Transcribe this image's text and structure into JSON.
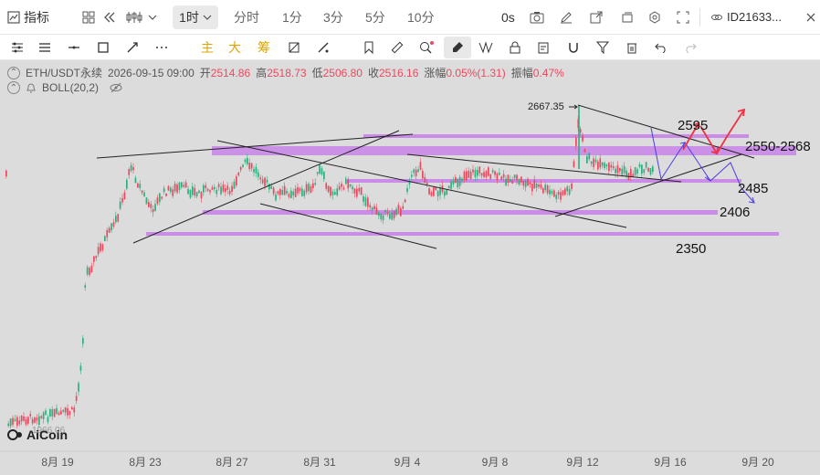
{
  "toolbar_top": {
    "indicator_label": "指标",
    "timeframe_selected": "1时",
    "timeframes": [
      "分时",
      "1分",
      "3分",
      "5分",
      "10分"
    ],
    "countdown": "0s",
    "account_id": "ID21633..."
  },
  "drawing_tools": {
    "main_label": "主",
    "big_label": "大",
    "chip_label": "筹"
  },
  "instrument": {
    "symbol": "ETH/USDT永续",
    "datetime": "2026-09-15 09:00",
    "open_label": "开",
    "open": "2514.86",
    "high_label": "高",
    "high": "2518.73",
    "low_label": "低",
    "low": "2506.80",
    "close_label": "收",
    "close": "2516.16",
    "change_label": "涨幅",
    "change": "0.05%(1.31)",
    "amplitude_label": "振幅",
    "amplitude": "0.47%"
  },
  "indicator": {
    "name": "BOLL(20,2)"
  },
  "brand": {
    "name": "AiCoin",
    "low_value": "1966.06"
  },
  "colors": {
    "up": "#2fae7e",
    "down": "#e84a5f",
    "band": "#c77ee8",
    "arrow_red": "#ee3344",
    "arrow_blue": "#4b3fe0"
  },
  "chart_data": {
    "type": "candlestick",
    "x_ticks": [
      "8月 19",
      "8月 23",
      "8月 27",
      "8月 31",
      "9月 4",
      "9月 8",
      "9月 12",
      "9月 16",
      "9月 20"
    ],
    "peak_label": "2667.35",
    "levels": [
      {
        "label": "2595",
        "value": 2595
      },
      {
        "label": "2550-2568",
        "value": 2559
      },
      {
        "label": "2485",
        "value": 2485
      },
      {
        "label": "2406",
        "value": 2406
      },
      {
        "label": "2350",
        "value": 2350
      }
    ]
  }
}
